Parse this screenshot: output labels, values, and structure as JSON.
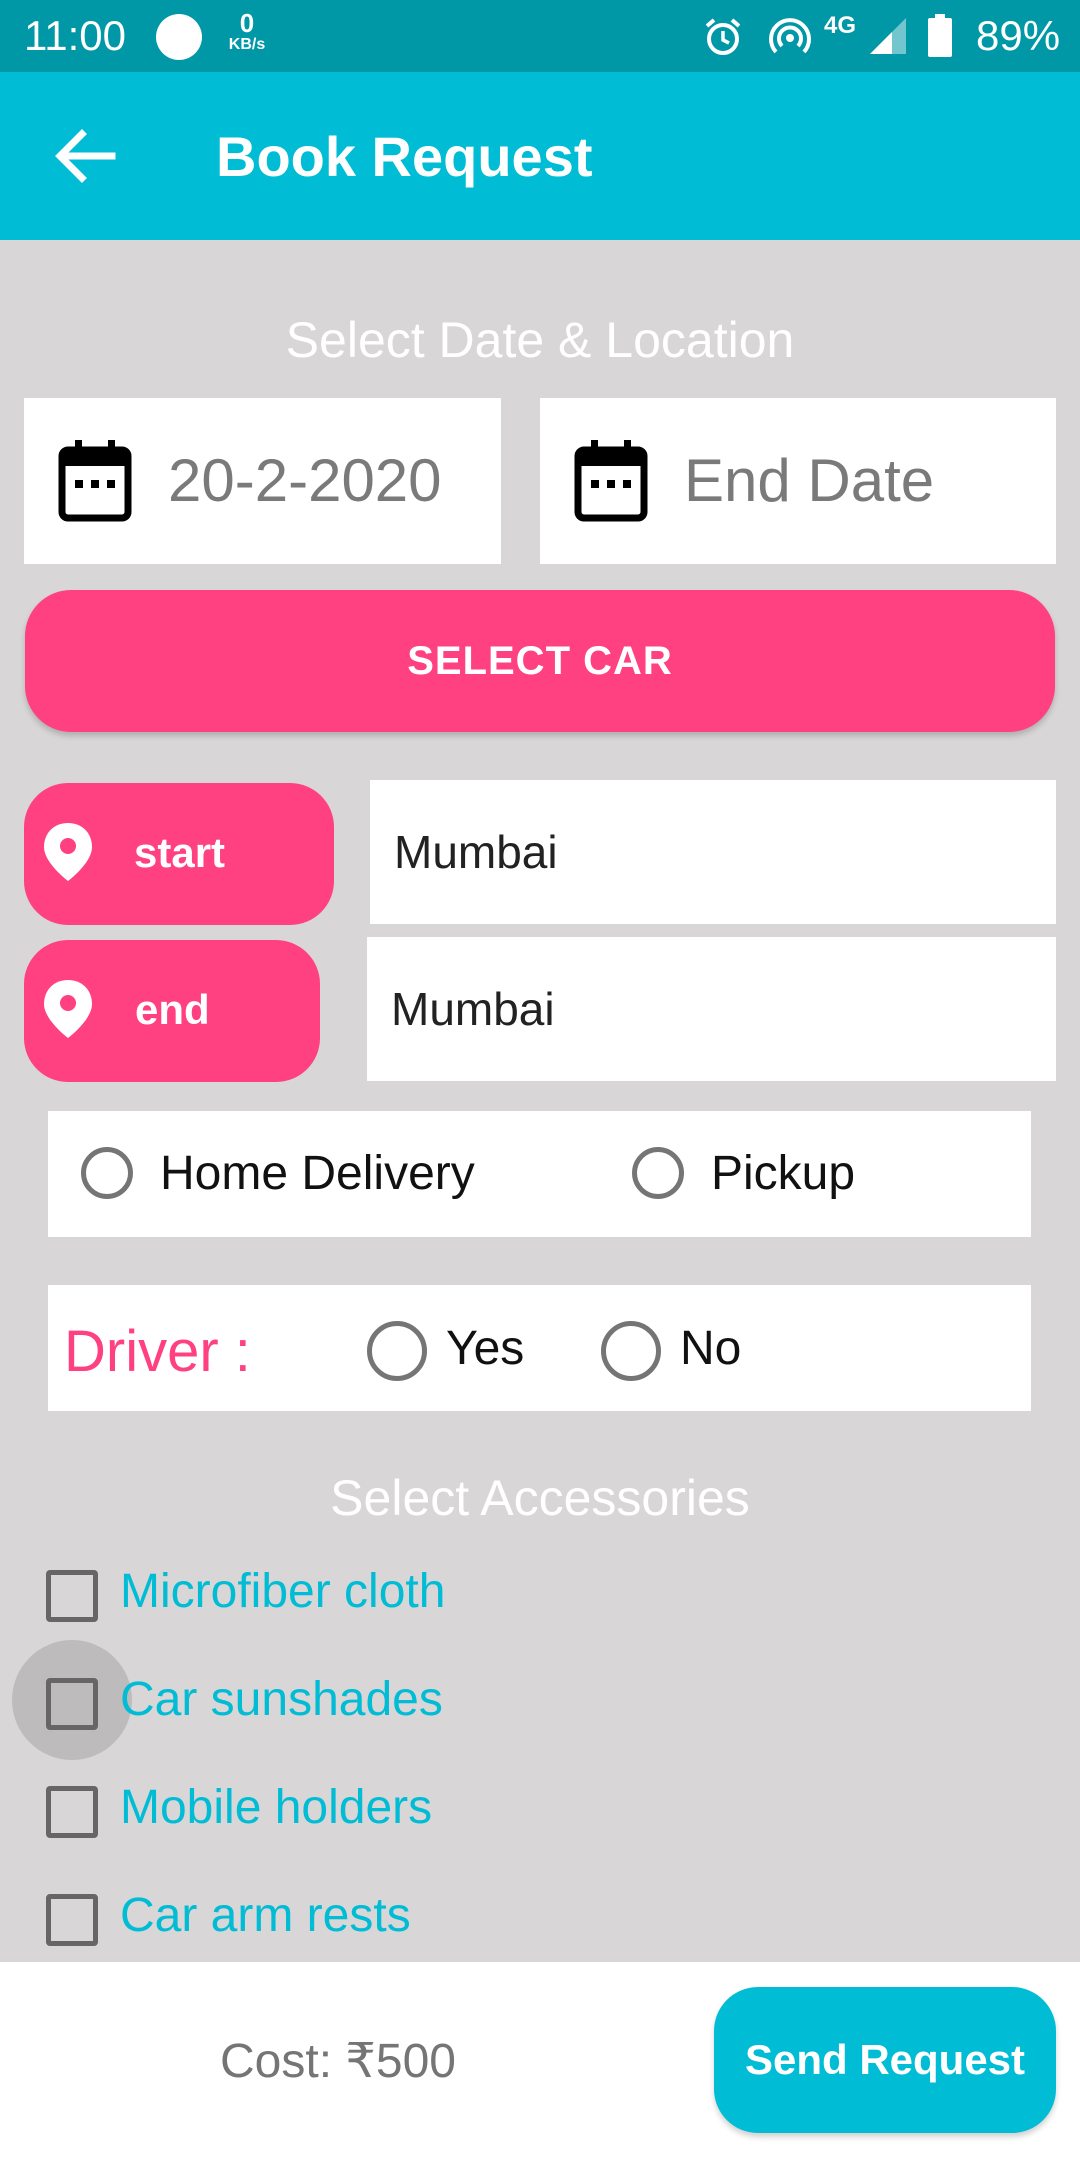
{
  "status_bar": {
    "time": "11:00",
    "net_speed_value": "0",
    "net_speed_unit": "KB/s",
    "network": "4G",
    "battery": "89%"
  },
  "app_bar": {
    "title": "Book Request",
    "back_icon": "arrow-back-icon"
  },
  "dates": {
    "section_title": "Select Date & Location",
    "start_date_value": "20-2-2020",
    "end_date_placeholder": "End Date",
    "calendar_icon": "calendar-icon"
  },
  "select_car_label": "SELECT CAR",
  "locations": {
    "start_label": "start",
    "start_value": "Mumbai",
    "end_label": "end",
    "end_value": "Mumbai",
    "pin_icon": "location-pin-icon"
  },
  "delivery": {
    "options": [
      "Home Delivery",
      "Pickup"
    ]
  },
  "driver": {
    "label": "Driver :",
    "options": [
      "Yes",
      "No"
    ]
  },
  "accessories": {
    "section_title": "Select Accessories",
    "items": [
      "Microfiber cloth",
      "Car sunshades",
      "Mobile holders",
      "Car arm rests"
    ]
  },
  "footer": {
    "cost_label": "Cost:",
    "cost_value": "₹500",
    "send_label": "Send Request"
  },
  "colors": {
    "primary": "#00bcd4",
    "primary_dark": "#0097a7",
    "accent": "#ff4081",
    "background": "#d8d6d7"
  }
}
